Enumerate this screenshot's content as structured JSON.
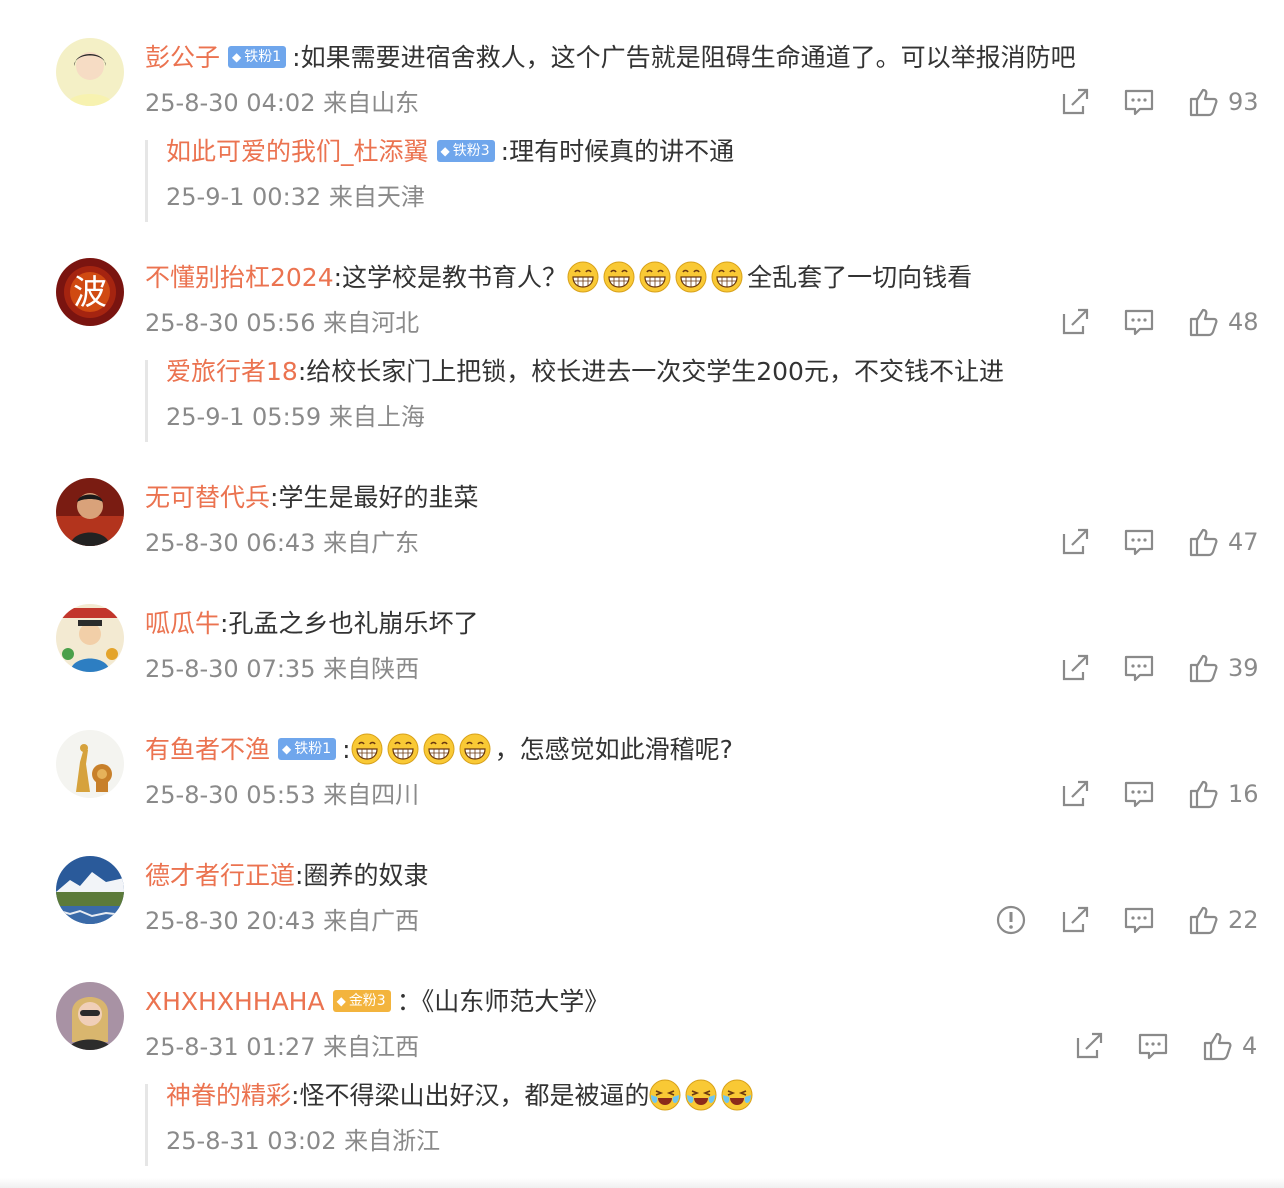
{
  "comments": [
    {
      "username": "彭公子",
      "badge": {
        "label": "铁粉1",
        "type": "blue"
      },
      "text": ":如果需要进宿舍救人，这个广告就是阻碍生命通道了。可以举报消防吧",
      "time": "25-8-30 04:02",
      "location": "来自山东",
      "likes": "93",
      "avatar_icon": "avatar-portrait",
      "reply": {
        "username": "如此可爱的我们_杜添翼",
        "badge": {
          "label": "铁粉3",
          "type": "blue"
        },
        "text": ":理有时候真的讲不通",
        "time": "25-9-1 00:32",
        "location": "来自天津"
      }
    },
    {
      "username": "不懂别抬杠2024",
      "text_before": ":这学校是教书育人？",
      "emoji_count": 5,
      "text_after": "全乱套了一切向钱看",
      "time": "25-8-30 05:56",
      "location": "来自河北",
      "likes": "48",
      "avatar_icon": "avatar-calligraphy",
      "avatar_char": "波",
      "reply": {
        "username": "爱旅行者18",
        "text": ":给校长家门上把锁，校长进去一次交学生200元，不交钱不让进",
        "time": "25-9-1 05:59",
        "location": "来自上海"
      }
    },
    {
      "username": "无可替代兵",
      "text": ":学生是最好的韭菜",
      "time": "25-8-30 06:43",
      "location": "来自广东",
      "likes": "47",
      "avatar_icon": "avatar-man"
    },
    {
      "username": "呱瓜牛",
      "text": ":孔孟之乡也礼崩乐坏了",
      "time": "25-8-30 07:35",
      "location": "来自陕西",
      "likes": "39",
      "avatar_icon": "avatar-deity"
    },
    {
      "username": "有鱼者不渔",
      "badge": {
        "label": "铁粉1",
        "type": "blue"
      },
      "text_before": ":",
      "emoji_count": 4,
      "text_after": "，怎感觉如此滑稽呢?",
      "time": "25-8-30 05:53",
      "location": "来自四川",
      "likes": "16",
      "avatar_icon": "avatar-animals"
    },
    {
      "username": "德才者行正道",
      "text": ":圈养的奴隶",
      "time": "25-8-30 20:43",
      "location": "来自广西",
      "likes": "22",
      "has_report": true,
      "avatar_icon": "avatar-landscape"
    },
    {
      "username": "XHXHXHHAHA",
      "badge": {
        "label": "金粉3",
        "type": "gold"
      },
      "text": "：《山东师范大学》",
      "time": "25-8-31 01:27",
      "location": "来自江西",
      "likes": "4",
      "avatar_icon": "avatar-woman",
      "reply": {
        "username": "神眷的精彩",
        "text_before": ":怪不得梁山出好汉，都是被逼的",
        "emoji_count": 3,
        "text_after": "",
        "time": "25-8-31 03:02",
        "location": "来自浙江"
      }
    }
  ],
  "icons": {
    "share": "share-icon",
    "comment": "comment-icon",
    "like": "thumbs-up-icon",
    "report": "report-icon",
    "grin_emoji": "grin-emoji",
    "laugh_cry_emoji": "laugh-cry-emoji"
  },
  "colors": {
    "username": "#eb7350",
    "meta": "#8a8a8a",
    "text": "#333333",
    "badge_blue": "#6fa6ec",
    "badge_gold": "#f3b43d"
  }
}
